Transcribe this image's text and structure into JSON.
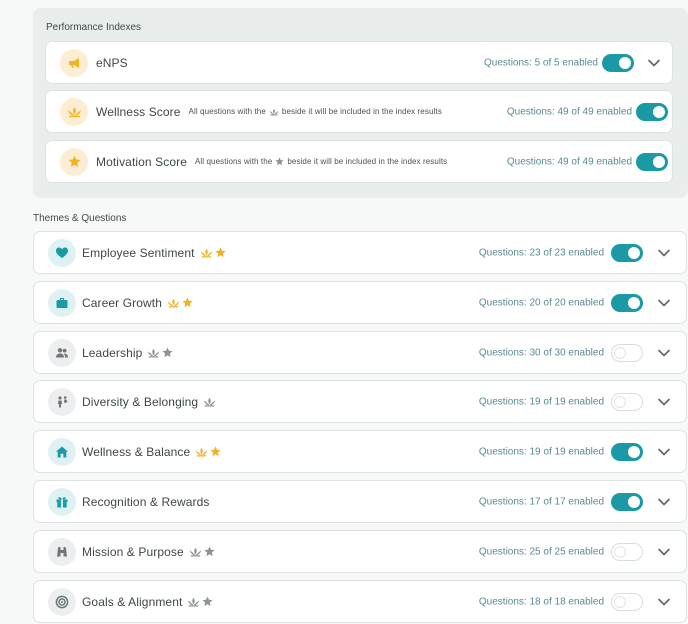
{
  "performance": {
    "title": "Performance Indexes",
    "items": [
      {
        "label": "eNPS",
        "note": "",
        "questions": "Questions: 5 of 5 enabled",
        "enabled": true
      },
      {
        "label": "Wellness Score",
        "note_pre": "All questions with the",
        "note_post": "beside it will be included in the index results",
        "questions": "Questions: 49 of 49 enabled",
        "enabled": true
      },
      {
        "label": "Motivation Score",
        "note_pre": "All questions with the",
        "note_post": "beside it will be included in the index results",
        "questions": "Questions: 49 of 49 enabled",
        "enabled": true
      }
    ]
  },
  "themes": {
    "title": "Themes & Questions",
    "items": [
      {
        "label": "Employee Sentiment",
        "icon": "heart-icon",
        "questions": "Questions: 23 of 23 enabled",
        "enabled": true
      },
      {
        "label": "Career Growth",
        "icon": "briefcase-icon",
        "questions": "Questions: 20 of 20 enabled",
        "enabled": true
      },
      {
        "label": "Leadership",
        "icon": "people-icon",
        "questions": "Questions: 30 of 30 enabled",
        "enabled": false
      },
      {
        "label": "Diversity & Belonging",
        "icon": "diversity-icon",
        "questions": "Questions: 19 of 19 enabled",
        "enabled": false
      },
      {
        "label": "Wellness & Balance",
        "icon": "home-icon",
        "questions": "Questions: 19 of 19 enabled",
        "enabled": true
      },
      {
        "label": "Recognition & Rewards",
        "icon": "gift-icon",
        "questions": "Questions: 17 of 17 enabled",
        "enabled": true
      },
      {
        "label": "Mission & Purpose",
        "icon": "binoculars-icon",
        "questions": "Questions: 25 of 25 enabled",
        "enabled": false
      },
      {
        "label": "Goals & Alignment",
        "icon": "target-icon",
        "questions": "Questions: 18 of 18 enabled",
        "enabled": false
      }
    ]
  },
  "colors": {
    "accent": "#1b9aa5",
    "gold": "#f0b323",
    "gray_icon": "#8c9396"
  }
}
